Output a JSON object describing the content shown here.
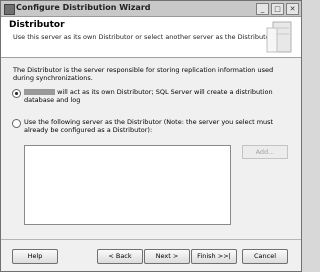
{
  "window": {
    "title": "Configure Distribution Wizard",
    "controls": [
      "_",
      "□",
      "✕"
    ]
  },
  "header": {
    "title": "Distributor",
    "subtitle": "Use this server as its own Distributor or select another server as the Distributor."
  },
  "content": {
    "description": "The Distributor is the server responsible for storing replication information used during synchronizations.",
    "option1_label": "will act as its own Distributor; SQL Server will create a distribution database and log",
    "option1_selected": true,
    "option2_label": "Use the following server as the Distributor (Note: the server you select must already be configured as a Distributor):",
    "option2_selected": false,
    "add_label": "Add..."
  },
  "buttons": {
    "help": "Help",
    "back": "< Back",
    "next": "Next >",
    "finish": "Finish >>|",
    "cancel": "Cancel"
  }
}
